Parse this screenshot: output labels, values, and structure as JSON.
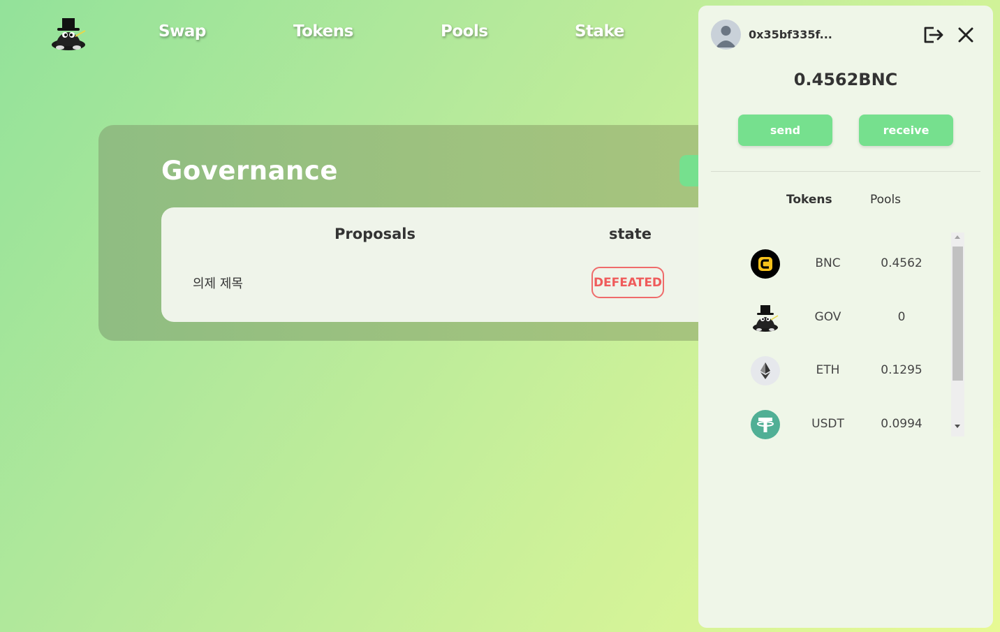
{
  "nav": {
    "links": [
      "Swap",
      "Tokens",
      "Pools",
      "Stake"
    ]
  },
  "governance": {
    "title": "Governance",
    "columns": {
      "proposals": "Proposals",
      "state": "state"
    },
    "rows": [
      {
        "title": "의제 제목",
        "state": "DEFEATED"
      }
    ]
  },
  "wallet": {
    "address": "0x35bf335f...",
    "balance": "0.4562BNC",
    "send_label": "send",
    "receive_label": "receive",
    "tabs": [
      "Tokens",
      "Pools"
    ],
    "active_tab": "Tokens",
    "tokens": [
      {
        "symbol": "BNC",
        "amount": "0.4562",
        "icon": "bnc-coin-icon"
      },
      {
        "symbol": "GOV",
        "amount": "0",
        "icon": "gov-mascot-icon"
      },
      {
        "symbol": "ETH",
        "amount": "0.1295",
        "icon": "ethereum-icon"
      },
      {
        "symbol": "USDT",
        "amount": "0.0994",
        "icon": "tether-icon"
      }
    ]
  },
  "colors": {
    "accent": "#76e08e",
    "defeated": "#ef5b5b",
    "panel": "#eff6e8",
    "card": "#9cc17f"
  }
}
